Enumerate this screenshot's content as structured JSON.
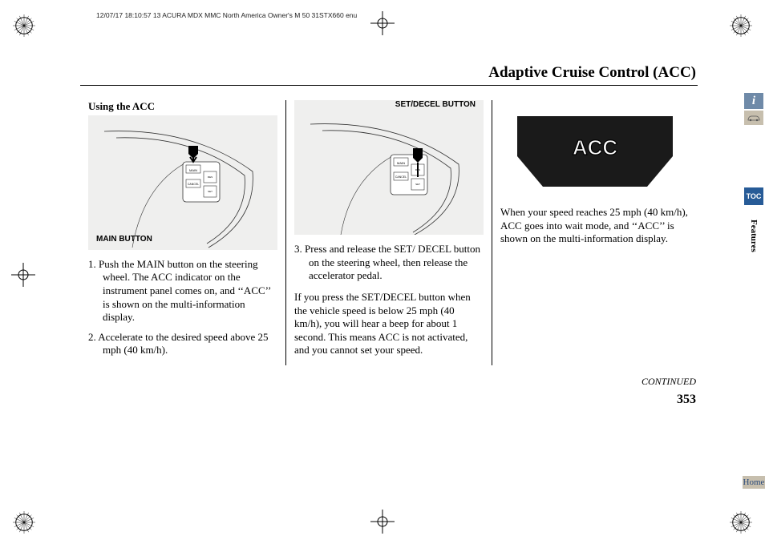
{
  "header_meta": "12/07/17 18:10:57   13 ACURA MDX MMC North America Owner's M 50 31STX660 enu",
  "title": "Adaptive Cruise Control (ACC)",
  "subhead": "Using the ACC",
  "fig1_label": "MAIN BUTTON",
  "fig2_label": "SET/DECEL BUTTON",
  "acc_badge": "ACC",
  "col1": {
    "step1": "Push the MAIN button on the steering wheel. The ACC indicator on the instrument panel comes on, and ‘‘ACC’’ is shown on the multi-information display.",
    "step2": "Accelerate to the desired speed above 25 mph (40 km/h)."
  },
  "col2": {
    "step3": "Press and release the SET/ DECEL button on the steering wheel, then release the accelerator pedal.",
    "para1": "If you press the SET/DECEL button when the vehicle speed is below 25 mph (40 km/h), you will hear a beep for about 1 second. This means ACC is not activated, and you cannot set your speed."
  },
  "col3": {
    "para1": "When your speed reaches 25 mph (40 km/h), ACC goes into wait mode, and ‘‘ACC’’ is shown on the multi-information display."
  },
  "continued": "CONTINUED",
  "page_number": "353",
  "tabs": {
    "info": "i",
    "toc": "TOC",
    "features": "Features",
    "home": "Home"
  },
  "steering_buttons": {
    "main": "MAIN",
    "cancel": "CANCEL",
    "res": "RES ACCEL",
    "set": "SET DECEL"
  }
}
